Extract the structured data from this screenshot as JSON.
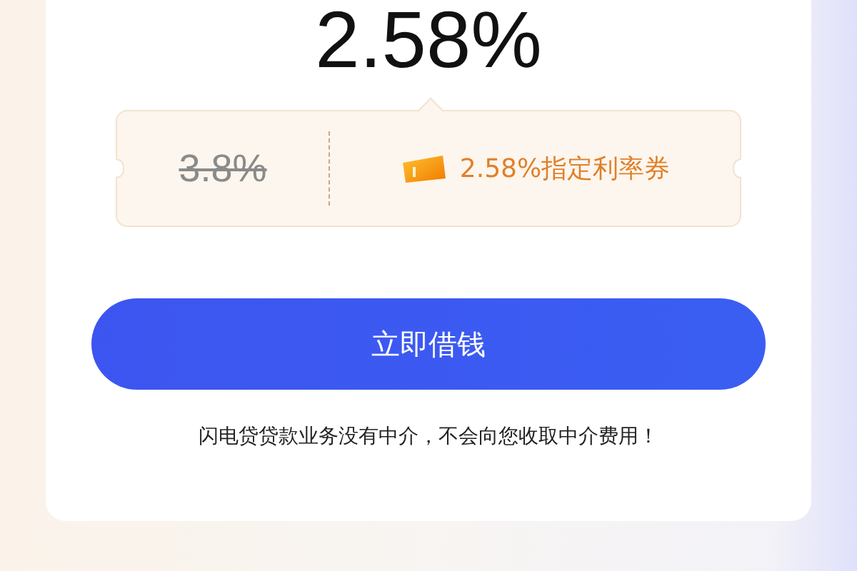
{
  "rate": "2.58%",
  "coupon": {
    "original_rate": "3.8%",
    "label": "2.58%指定利率券"
  },
  "button": "立即借钱",
  "notice": "闪电贷贷款业务没有中介，不会向您收取中介费用！"
}
